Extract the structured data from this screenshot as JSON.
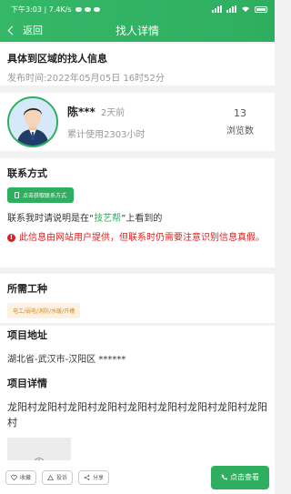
{
  "status_bar": {
    "time_speed": "下午3:03 | 7.4K/s"
  },
  "nav": {
    "back_label": "返回",
    "title": "找人详情"
  },
  "header": {
    "title": "具体到区域的找人信息",
    "publish_time": "发布时间:2022年05月05日 16时52分"
  },
  "user": {
    "name": "陈***",
    "ago": "2天前",
    "usage": "累计使用2303小时",
    "views_count": "13",
    "views_label": "浏览数"
  },
  "contact": {
    "section_title": "联系方式",
    "button_label": "点击获取联系方式",
    "tip_prefix": "联系我时请说明是在“",
    "tip_brand": "技艺帮",
    "tip_suffix": "”上看到的",
    "warning": "此信息由网站用户提供，但联系时仍需要注意识别信息真假。"
  },
  "job": {
    "section_title": "所需工种",
    "tag": "电工/弱电/消防/水暖/开槽"
  },
  "project": {
    "address_title": "项目地址",
    "address": "湖北省-武汉市-汉阳区 ******",
    "detail_title": "项目详情",
    "detail_text": "龙阳村龙阳村龙阳村龙阳村龙阳村龙阳村龙阳村龙阳村龙阳村"
  },
  "actions": {
    "favorite": "收藏",
    "complain": "投诉",
    "share": "分享",
    "view": "点击查看"
  },
  "colors": {
    "primary_green": "#2fae60",
    "warning_red": "#e02020",
    "tag_orange": "#d88a1c"
  }
}
